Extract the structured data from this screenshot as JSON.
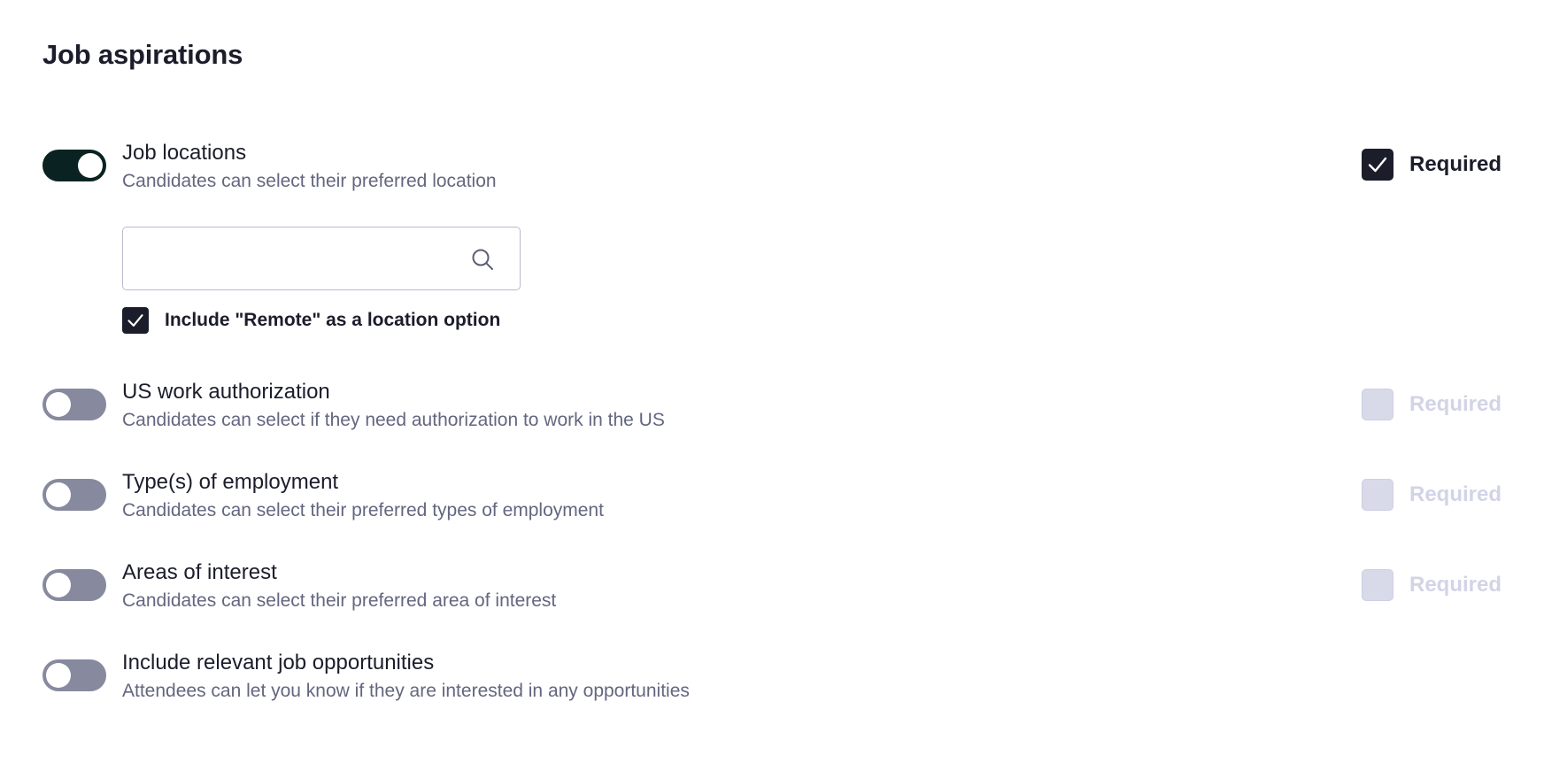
{
  "page": {
    "title": "Job aspirations"
  },
  "settings": [
    {
      "title": "Job locations",
      "description": "Candidates can select their preferred location",
      "enabled": true,
      "required_label": "Required",
      "required_checked": true
    },
    {
      "title": "US work authorization",
      "description": "Candidates can select if they need authorization to work in the US",
      "enabled": false,
      "required_label": "Required",
      "required_checked": false
    },
    {
      "title": "Type(s) of employment",
      "description": "Candidates can select their preferred types of employment",
      "enabled": false,
      "required_label": "Required",
      "required_checked": false
    },
    {
      "title": "Areas of interest",
      "description": "Candidates can select their preferred area of interest",
      "enabled": false,
      "required_label": "Required",
      "required_checked": false
    },
    {
      "title": "Include relevant job opportunities",
      "description": "Attendees can let you know if they are interested in any opportunities",
      "enabled": false
    }
  ],
  "location_search": {
    "value": "",
    "placeholder": "",
    "icon": "search-icon"
  },
  "remote_option": {
    "label": "Include \"Remote\" as a location option",
    "checked": true
  },
  "colors": {
    "toggle_on": "#0a2322",
    "toggle_off": "#878a9e",
    "checkbox_checked": "#1c1d2b",
    "checkbox_disabled": "#d8dae9",
    "text_primary": "#1c1d2b",
    "text_secondary": "#63667f",
    "required_disabled_text": "#d2d4e6"
  }
}
